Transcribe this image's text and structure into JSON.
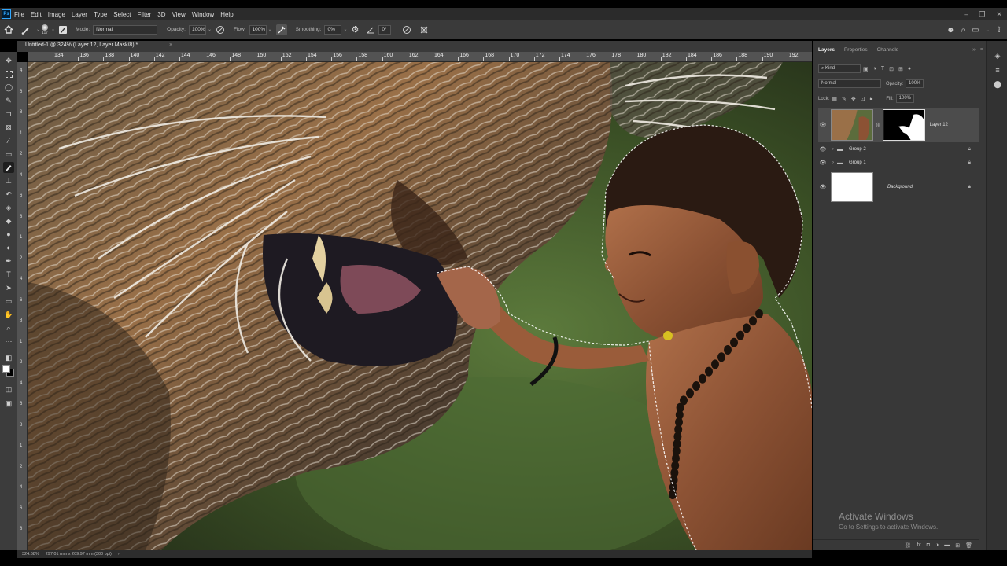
{
  "app": {
    "logo": "Ps"
  },
  "menubar": {
    "items": [
      "File",
      "Edit",
      "Image",
      "Layer",
      "Type",
      "Select",
      "Filter",
      "3D",
      "View",
      "Window",
      "Help"
    ],
    "window_controls": [
      "minimize-icon",
      "restore-icon",
      "close-icon"
    ]
  },
  "options": {
    "brush_size": "117",
    "mode_label": "Mode:",
    "mode_value": "Normal",
    "opacity_label": "Opacity:",
    "opacity_value": "100%",
    "flow_label": "Flow:",
    "flow_value": "100%",
    "smoothing_label": "Smoothing:",
    "smoothing_value": "0%",
    "angle_value": "0°"
  },
  "document": {
    "tab_title": "Untitled-1 @ 324% (Layer 12, Layer Mask/8) *",
    "close": "×"
  },
  "ruler": {
    "top_ticks": [
      "134",
      "136",
      "138",
      "140",
      "142",
      "144",
      "146",
      "148",
      "150",
      "152",
      "154",
      "156",
      "158",
      "160",
      "162",
      "164",
      "166",
      "168",
      "170",
      "172",
      "174",
      "176",
      "178",
      "180",
      "182",
      "184",
      "186",
      "188",
      "190",
      "192",
      "194"
    ],
    "left_ticks": [
      "4",
      "6",
      "8",
      "1",
      "2",
      "4",
      "6",
      "8",
      "1",
      "2",
      "4",
      "6",
      "8",
      "1",
      "2",
      "4",
      "6",
      "8",
      "1",
      "2",
      "4",
      "6",
      "8"
    ]
  },
  "statusbar": {
    "zoom": "324.68%",
    "doc_size": "297.01 mm x 209.97 mm (300 ppi)"
  },
  "layers_panel": {
    "tabs": [
      "Layers",
      "Properties",
      "Channels"
    ],
    "filter_kind": "Kind",
    "blend_mode": "Normal",
    "opacity_label": "Opacity:",
    "opacity_value": "100%",
    "lock_label": "Lock:",
    "fill_label": "Fill:",
    "fill_value": "100%",
    "layers": [
      {
        "name": "Layer 12",
        "selected": true
      },
      {
        "name": "Group 2"
      },
      {
        "name": "Group 1"
      },
      {
        "name": "Background"
      }
    ]
  },
  "watermark": {
    "line1": "Activate Windows",
    "line2": "Go to Settings to activate Windows."
  },
  "colors": {
    "menubar_bg": "#2b2b2b",
    "panel_bg": "#383838",
    "accent": "#31a8ff"
  }
}
